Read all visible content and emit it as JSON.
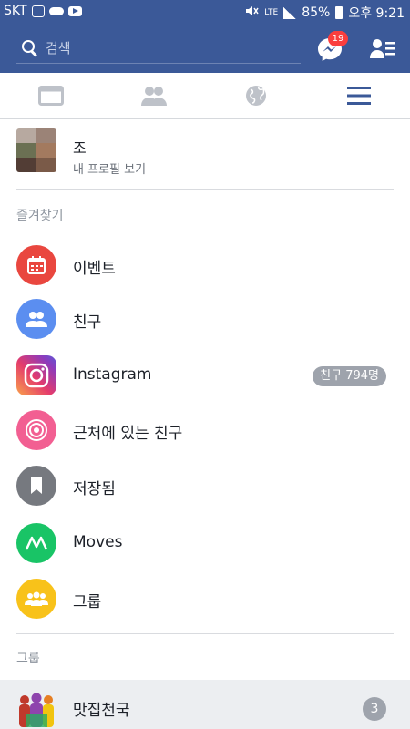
{
  "status_bar": {
    "carrier": "SKT",
    "network": "LTE",
    "battery": "85%",
    "time": "오후 9:21"
  },
  "header": {
    "search_placeholder": "검색",
    "messenger_badge": "19"
  },
  "tabs": [
    {
      "icon": "news-feed-icon"
    },
    {
      "icon": "friends-icon"
    },
    {
      "icon": "globe-icon"
    },
    {
      "icon": "menu-icon"
    }
  ],
  "profile": {
    "name": "조",
    "subtitle": "내 프로필 보기"
  },
  "favorites": {
    "title": "즐겨찾기",
    "items": [
      {
        "label": "이벤트",
        "icon": "calendar-icon",
        "color": "#e9473f"
      },
      {
        "label": "친구",
        "icon": "friends-icon",
        "color": "#5b8ef0"
      },
      {
        "label": "Instagram",
        "icon": "instagram-icon",
        "badge": "친구 794명"
      },
      {
        "label": "근처에 있는 친구",
        "icon": "nearby-icon",
        "color": "#f25f92"
      },
      {
        "label": "저장됨",
        "icon": "bookmark-icon",
        "color": "#76797f"
      },
      {
        "label": "Moves",
        "icon": "moves-icon",
        "color": "#19c466"
      },
      {
        "label": "그룹",
        "icon": "groups-icon",
        "color": "#f8c21a"
      }
    ]
  },
  "groups": {
    "title": "그룹",
    "items": [
      {
        "label": "맛집천국",
        "count": "3"
      }
    ]
  }
}
